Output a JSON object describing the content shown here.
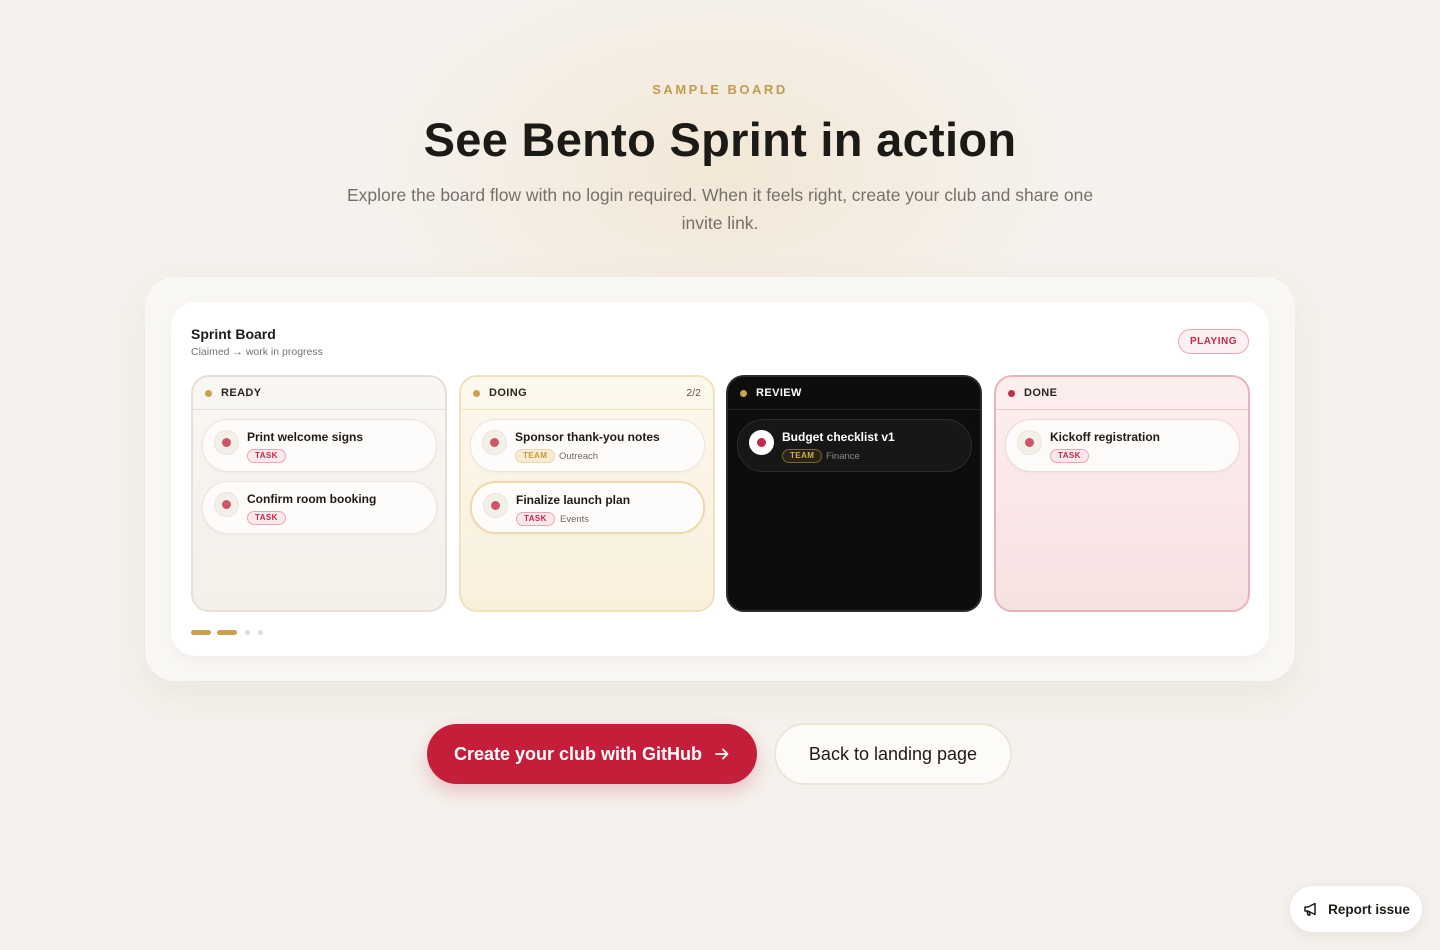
{
  "hero": {
    "eyebrow": "SAMPLE BOARD",
    "title": "See Bento Sprint in action",
    "subtitle": "Explore the board flow with no login required. When it feels right, create your club and share one invite link."
  },
  "board": {
    "title": "Sprint Board",
    "subtitle": "Claimed → work in progress",
    "status": "PLAYING",
    "columns": [
      {
        "name": "READY",
        "count": "",
        "cards": [
          {
            "title": "Print welcome signs",
            "tag": "TASK",
            "meta": ""
          },
          {
            "title": "Confirm room booking",
            "tag": "TASK",
            "meta": ""
          }
        ]
      },
      {
        "name": "DOING",
        "count": "2/2",
        "cards": [
          {
            "title": "Sponsor thank-you notes",
            "tag": "TEAM",
            "meta": "Outreach"
          },
          {
            "title": "Finalize launch plan",
            "tag": "TASK",
            "meta": "Events"
          }
        ]
      },
      {
        "name": "REVIEW",
        "count": "",
        "cards": [
          {
            "title": "Budget checklist v1",
            "tag": "TEAM",
            "meta": "Finance"
          }
        ]
      },
      {
        "name": "DONE",
        "count": "",
        "cards": [
          {
            "title": "Kickoff registration",
            "tag": "TASK",
            "meta": ""
          }
        ]
      }
    ]
  },
  "actions": {
    "primary_label": "Create your club with GitHub",
    "secondary_label": "Back to landing page"
  },
  "report": {
    "label": "Report issue"
  },
  "colors": {
    "accent": "#c41e3a",
    "gold": "#c9a24f",
    "background": "#f5f1ec"
  }
}
